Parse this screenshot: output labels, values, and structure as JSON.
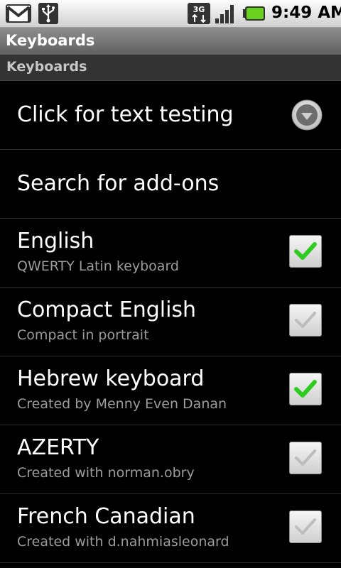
{
  "status_bar": {
    "time": "9:49 AM",
    "icons": [
      "gmail-icon",
      "usb-icon",
      "3g-network-icon",
      "signal-icon",
      "battery-icon"
    ],
    "network_label": "3G"
  },
  "title_bar": {
    "title": "Keyboards"
  },
  "section": {
    "header": "Keyboards"
  },
  "items": [
    {
      "title": "Click for text testing",
      "type": "dropdown"
    },
    {
      "title": "Search for add-ons",
      "type": "plain"
    },
    {
      "title": "English",
      "summary": "QWERTY Latin keyboard",
      "checked": true
    },
    {
      "title": "Compact English",
      "summary": "Compact in portrait",
      "checked": false
    },
    {
      "title": "Hebrew keyboard",
      "summary": "Created by Menny Even Danan",
      "checked": true
    },
    {
      "title": "AZERTY",
      "summary": "Created with norman.obry",
      "checked": false
    },
    {
      "title": "French Canadian",
      "summary": "Created with d.nahmiasleonard",
      "checked": false
    }
  ],
  "colors": {
    "check_on": "#2ecc20",
    "check_off": "#bdbdbd",
    "summary_text": "#9c9c9c"
  }
}
